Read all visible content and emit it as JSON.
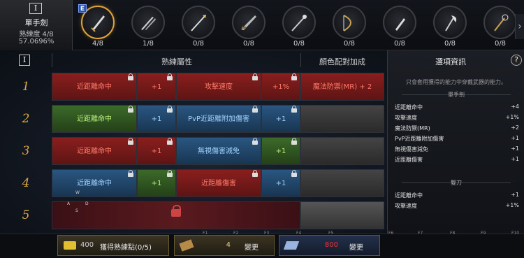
{
  "weapon": {
    "name": "單手劍",
    "proficiency": "熟練度 4/8",
    "percent": "57.0696%",
    "tier": "I"
  },
  "slots": [
    {
      "icon": "sword-icon",
      "count": "4/8",
      "active": true
    },
    {
      "icon": "dual-blade-icon",
      "count": "1/8"
    },
    {
      "icon": "spear-icon",
      "count": "0/8"
    },
    {
      "icon": "rifle-icon",
      "count": "0/8"
    },
    {
      "icon": "polearm-icon",
      "count": "0/8"
    },
    {
      "icon": "bow-icon",
      "count": "0/8"
    },
    {
      "icon": "dagger-icon",
      "count": "0/8"
    },
    {
      "icon": "axe-icon",
      "count": "0/8"
    },
    {
      "icon": "staff-icon",
      "count": "0/8"
    }
  ],
  "badge": "E",
  "header": {
    "tier": "I",
    "proficiency_label": "熟練屬性",
    "color_label": "顏色配對加成"
  },
  "rows": [
    {
      "num": "1",
      "a": "近距離命中",
      "av": "+1",
      "b": "攻擊速度",
      "bv": "+1%",
      "bonus": "魔法防禦(MR) + 2",
      "colors": [
        "red",
        "red",
        "red",
        "red",
        "red"
      ]
    },
    {
      "num": "2",
      "a": "近距離命中",
      "av": "+1",
      "b": "PvP近距離附加傷害",
      "bv": "+1",
      "bonus": "",
      "colors": [
        "green",
        "blue",
        "blue",
        "blue",
        "grey"
      ]
    },
    {
      "num": "3",
      "a": "近距離命中",
      "av": "+1",
      "b": "無視傷害減免",
      "bv": "+1",
      "bonus": "",
      "colors": [
        "red",
        "red",
        "blue",
        "green",
        "grey"
      ]
    },
    {
      "num": "4",
      "a": "近距離命中",
      "av": "+1",
      "b": "近距離傷害",
      "bv": "+1",
      "bonus": "",
      "colors": [
        "blue",
        "green",
        "red",
        "blue",
        "grey"
      ]
    },
    {
      "num": "5"
    }
  ],
  "compass": {
    "n": "W",
    "w": "A",
    "e": "D",
    "s": "S"
  },
  "panel": {
    "title": "選項資訊",
    "desc": "只會套用獲得的能力中穿戴武器的能力。",
    "sections": [
      {
        "name": "單手劍",
        "options": [
          {
            "label": "近距離命中",
            "value": "+4"
          },
          {
            "label": "攻擊速度",
            "value": "+1%"
          },
          {
            "label": "魔法防禦(MR)",
            "value": "+2"
          },
          {
            "label": "PvP近距離附加傷害",
            "value": "+1"
          },
          {
            "label": "無視傷害減免",
            "value": "+1"
          },
          {
            "label": "近距離傷害",
            "value": "+1"
          }
        ]
      },
      {
        "name": "雙刀",
        "options": [
          {
            "label": "近距離命中",
            "value": "+1"
          },
          {
            "label": "攻擊速度",
            "value": "+1%"
          }
        ]
      }
    ]
  },
  "bottom": {
    "gain_amount": "400",
    "gain_label": "獲得熟練點(0/5)",
    "change1_amount": "4",
    "change1_label": "變更",
    "change2_amount": "800",
    "change2_label": "變更",
    "fkeys": [
      "F1",
      "F2",
      "F3",
      "F4",
      "F5",
      "F6",
      "F7",
      "F8",
      "F9",
      "F10"
    ]
  },
  "colors": {
    "accent": "#e0a23a",
    "red": "#8a1e1e",
    "green": "#3c6a2a",
    "blue": "#2a5680"
  }
}
